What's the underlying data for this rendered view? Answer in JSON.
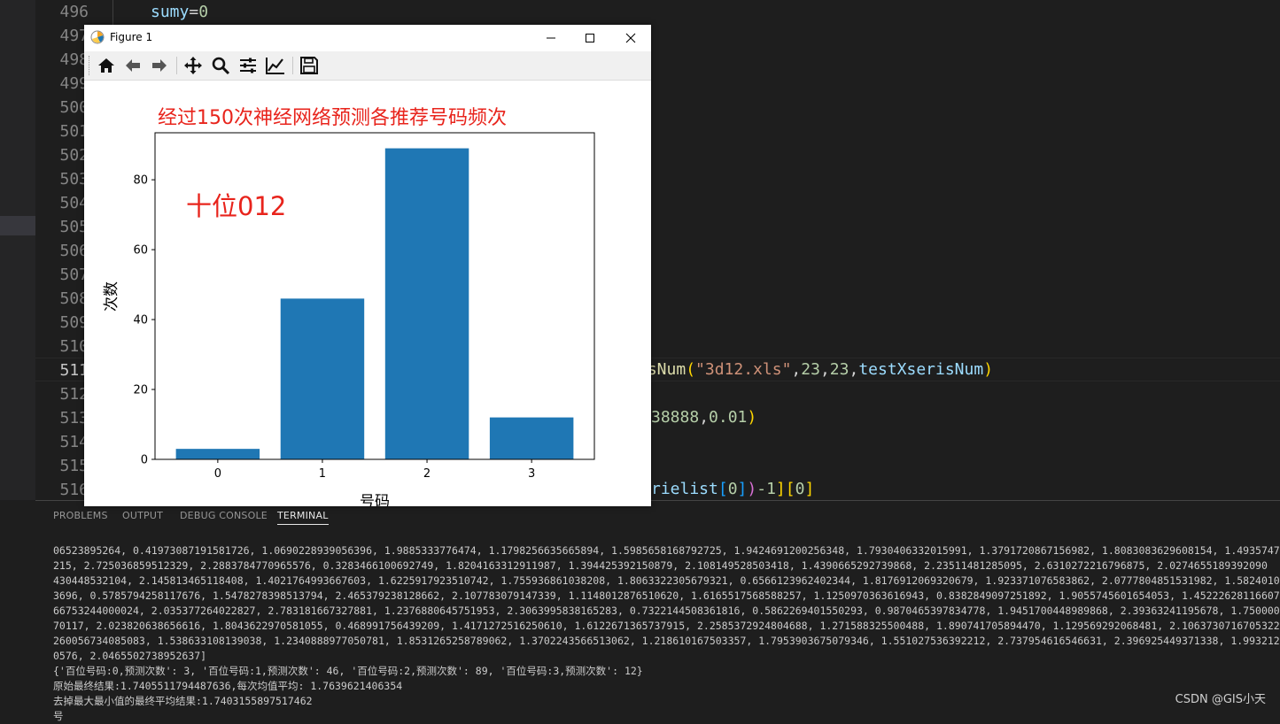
{
  "editor": {
    "line_numbers": [
      "496",
      "497",
      "498",
      "499",
      "500",
      "501",
      "502",
      "503",
      "504",
      "505",
      "506",
      "507",
      "508",
      "509",
      "510",
      "511",
      "512",
      "513",
      "514",
      "515",
      "516"
    ],
    "visible_code": {
      "l496": {
        "var": "sumy",
        "op": "=",
        "num": "0"
      },
      "l511": {
        "fn": "esNum",
        "open": "(",
        "str": "\"3d12.xls\"",
        "c1": ",",
        "n1": "23",
        "c2": ",",
        "n2": "23",
        "c3": ",",
        "var": "testXserisNum",
        "close": ")"
      },
      "l513": {
        "num": "38888",
        "comma": ",",
        "num2": "0.01",
        "close": ")"
      },
      "l516": {
        "text": "rielist",
        "b1": "[",
        "n0": "0",
        "b2": "]",
        "close1": ")",
        "minus": "-1",
        "close2": "]",
        "b3": "[",
        "n00": "0",
        "b4": "]"
      }
    }
  },
  "panel": {
    "tabs": [
      "PROBLEMS",
      "OUTPUT",
      "DEBUG CONSOLE",
      "TERMINAL"
    ],
    "active_tab": "TERMINAL",
    "terminal_lines": [
      "06523895264, 0.41973087191581726, 1.0690228939056396, 1.9885333776474, 1.1798256635665894, 1.5985658168792725, 1.9424691200256348, 1.7930406332015991, 1.3791720867156982, 1.8083083629608154, 1.4935747480392456",
      "215, 2.725036859512329, 2.2883784770965576, 0.3283466100692749, 1.8204163312911987, 1.394425392150879, 2.108149528503418, 1.4390665292739868, 2.23511481285095, 2.6310272216796875, 2.0274655189392090",
      "430448532104, 2.145813465118408, 1.4021764993667603, 1.6225917923510742, 1.755936861038208, 1.8063322305679321, 0.6566123962402344, 1.8176912069320679, 1.923371076583862, 2.0777804851531982, 1.5824010372161865",
      "3696, 0.5785794258117676, 1.5478278398513794, 2.465379238128662, 2.107783079147339, 1.1148012876510620, 1.6165517568588257, 1.1250970363616943, 0.8382849097251892, 1.9055745601654053, 1.4522262811660767",
      "66753244000024, 2.035377264022827, 2.783181667327881, 1.2376880645751953, 2.3063995838165283, 0.7322144508361816, 0.5862269401550293, 0.9870465397834778, 1.9451700448989868, 2.39363241195678, 1.7500000000000000",
      "70117, 2.023820638656616, 1.8043622970581055, 0.468991756439209, 1.4171272516250610, 1.6122671365737915, 2.2585372924804688, 1.271588325500488, 1.890741705894470, 1.129569292068481, 2.1063730716705322",
      "260056734085083, 1.538633108139038, 1.2340888977050781, 1.8531265258789062, 1.3702243566513062, 1.218610167503357, 1.7953903675079346, 1.551027536392212, 2.737954616546631, 2.396925449371338, 1.9932129383087158",
      "0576, 2.0465502738952637]",
      "{'百位号码:0,预测次数': 3, '百位号码:1,预测次数': 46, '百位号码:2,预测次数': 89, '百位号码:3,预测次数': 12}",
      "原始最终结果:1.7405511794487636,每次均值平均: 1.7639621406354",
      "去掉最大最小值的最终平均结果:1.7403155897517462",
      "号"
    ],
    "watermark": "CSDN @GIS小天"
  },
  "figure_window": {
    "title": "Figure 1",
    "controls": {
      "minimize": "minimize-icon",
      "maximize": "maximize-icon",
      "close": "close-icon"
    },
    "toolbar_icons": [
      "home-icon",
      "back-icon",
      "forward-icon",
      "pan-icon",
      "zoom-icon",
      "configure-subplots-icon",
      "edit-axis-icon",
      "save-icon"
    ]
  },
  "chart_data": {
    "type": "bar",
    "title": "经过150次神经网络预测各推荐号码频次",
    "annotation": "十位012",
    "xlabel": "号码",
    "ylabel": "次数",
    "categories": [
      "0",
      "1",
      "2",
      "3"
    ],
    "values": [
      3,
      46,
      89,
      12
    ],
    "yticks": [
      "0",
      "20",
      "40",
      "60",
      "80"
    ],
    "ylim": [
      0,
      93.45
    ],
    "bar_color": "#1f77b4",
    "title_color": "#e8241c",
    "annotation_color": "#e8241c",
    "grid": false
  }
}
